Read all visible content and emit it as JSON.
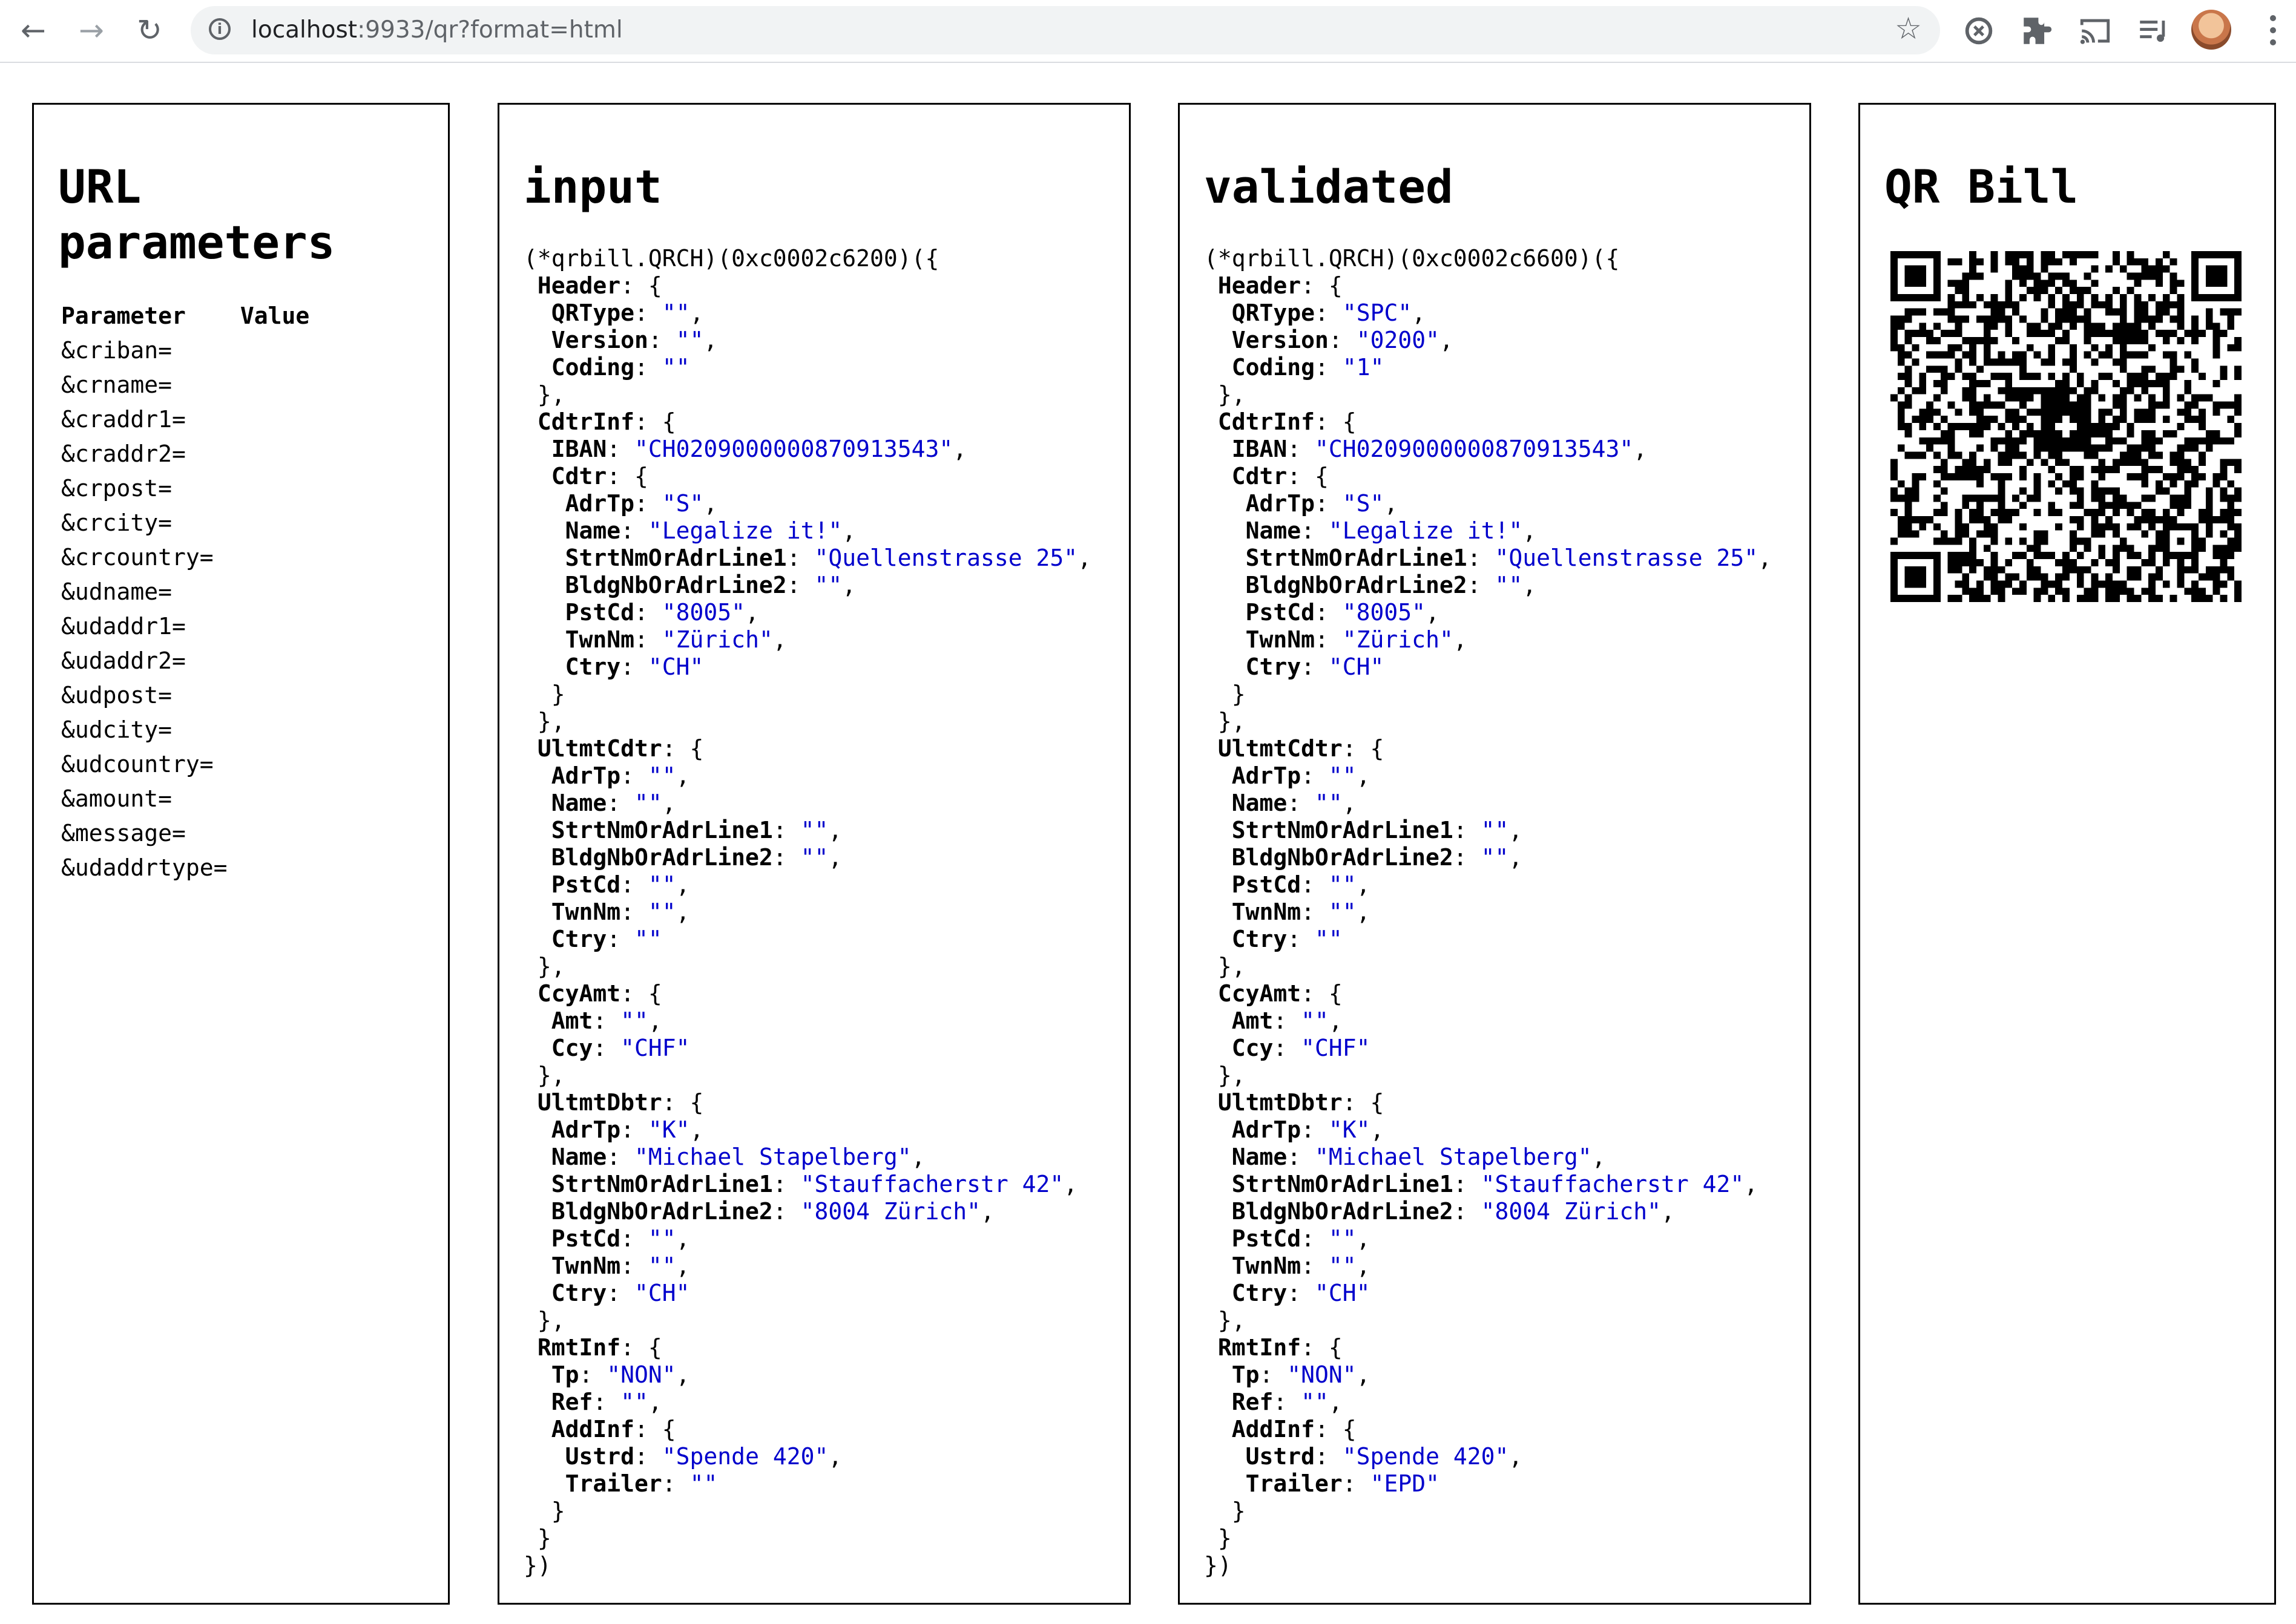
{
  "browser": {
    "url_host": "localhost",
    "url_rest": ":9933/qr?format=html"
  },
  "panels": {
    "url_params": {
      "title": "URL parameters",
      "col_parameter": "Parameter",
      "col_value": "Value",
      "rows": [
        "&criban=",
        "&crname=",
        "&craddr1=",
        "&craddr2=",
        "&crpost=",
        "&crcity=",
        "&crcountry=",
        "&udname=",
        "&udaddr1=",
        "&udaddr2=",
        "&udpost=",
        "&udcity=",
        "&udcountry=",
        "&amount=",
        "&message=",
        "&udaddrtype="
      ]
    },
    "input": {
      "title": "input",
      "address": "0xc0002c6200",
      "values": {
        "QRType": "",
        "Version": "",
        "Coding": "",
        "IBAN": "CH0209000000870913543",
        "Cdtr": {
          "AdrTp": "S",
          "Name": "Legalize it!",
          "StrtNmOrAdrLine1": "Quellenstrasse 25",
          "BldgNbOrAdrLine2": "",
          "PstCd": "8005",
          "TwnNm": "Zürich",
          "Ctry": "CH"
        },
        "UltmtCdtr": {
          "AdrTp": "",
          "Name": "",
          "StrtNmOrAdrLine1": "",
          "BldgNbOrAdrLine2": "",
          "PstCd": "",
          "TwnNm": "",
          "Ctry": ""
        },
        "Amt": "",
        "Ccy": "CHF",
        "UltmtDbtr": {
          "AdrTp": "K",
          "Name": "Michael Stapelberg",
          "StrtNmOrAdrLine1": "Stauffacherstr 42",
          "BldgNbOrAdrLine2": "8004 Zürich",
          "PstCd": "",
          "TwnNm": "",
          "Ctry": "CH"
        },
        "Tp": "NON",
        "Ref": "",
        "Ustrd": "Spende 420",
        "Trailer": ""
      }
    },
    "validated": {
      "title": "validated",
      "address": "0xc0002c6600",
      "values": {
        "QRType": "SPC",
        "Version": "0200",
        "Coding": "1",
        "IBAN": "CH0209000000870913543",
        "Cdtr": {
          "AdrTp": "S",
          "Name": "Legalize it!",
          "StrtNmOrAdrLine1": "Quellenstrasse 25",
          "BldgNbOrAdrLine2": "",
          "PstCd": "8005",
          "TwnNm": "Zürich",
          "Ctry": "CH"
        },
        "UltmtCdtr": {
          "AdrTp": "",
          "Name": "",
          "StrtNmOrAdrLine1": "",
          "BldgNbOrAdrLine2": "",
          "PstCd": "",
          "TwnNm": "",
          "Ctry": ""
        },
        "Amt": "",
        "Ccy": "CHF",
        "UltmtDbtr": {
          "AdrTp": "K",
          "Name": "Michael Stapelberg",
          "StrtNmOrAdrLine1": "Stauffacherstr 42",
          "BldgNbOrAdrLine2": "8004 Zürich",
          "PstCd": "",
          "TwnNm": "",
          "Ctry": "CH"
        },
        "Tp": "NON",
        "Ref": "",
        "Ustrd": "Spende 420",
        "Trailer": "EPD"
      }
    },
    "qr": {
      "title": "QR Bill"
    }
  },
  "icons": {
    "back": "arrow-left",
    "forward": "arrow-right",
    "reload": "reload",
    "site_info": "info-circle",
    "bookmark": "star",
    "extensions": [
      "sync-icon",
      "puzzle-icon",
      "cast-icon",
      "media-icon"
    ],
    "menu": "kebab-menu"
  },
  "colors": {
    "string": "#0000cc",
    "border": "#000000"
  }
}
